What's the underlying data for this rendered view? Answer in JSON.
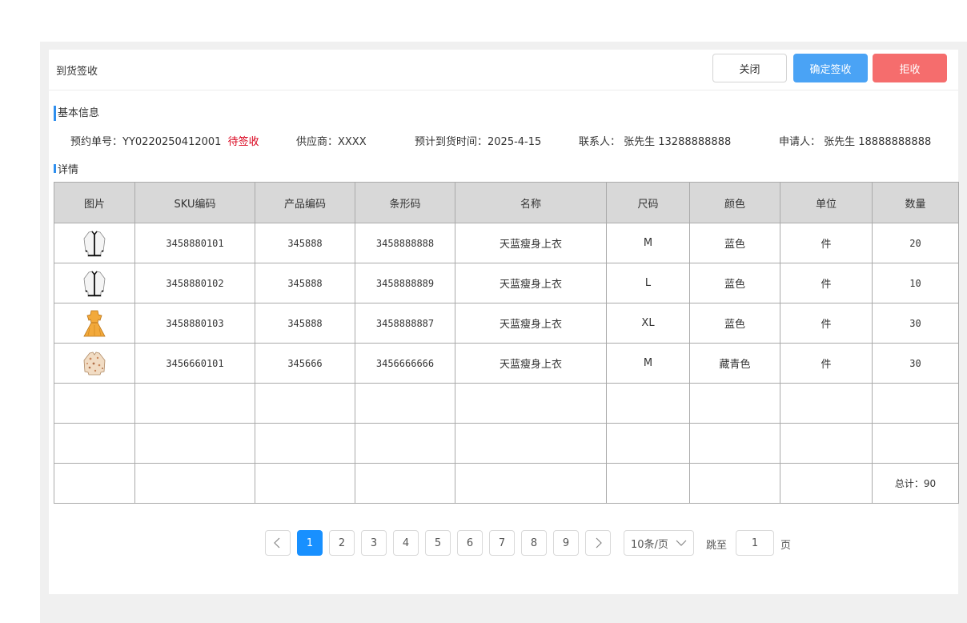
{
  "header": {
    "title": "到货签收",
    "close_label": "关闭",
    "confirm_label": "确定签收",
    "reject_label": "拒收"
  },
  "basic": {
    "section_title": "基本信息",
    "order_label": "预约单号：",
    "order_no": "YY0220250412001",
    "status": "待签收",
    "supplier": "供应商：XXXX",
    "eta": "预计到货时间：2025-4-15",
    "contact": "联系人：  张先生  13288888888",
    "applicant": "申请人：  张先生 18888888888"
  },
  "detail": {
    "section_title": "详情",
    "columns": [
      "图片",
      "SKU编码",
      "产品编码",
      "条形码",
      "名称",
      "尺码",
      "颜色",
      "单位",
      "数量"
    ],
    "rows": [
      {
        "image": "white-cardigan-icon",
        "sku": "3458880101",
        "product_code": "345888",
        "barcode": "3458888888",
        "name": "天蓝瘦身上衣",
        "size": "M",
        "color": "蓝色",
        "unit": "件",
        "qty": "20"
      },
      {
        "image": "white-cardigan-icon",
        "sku": "3458880102",
        "product_code": "345888",
        "barcode": "3458888889",
        "name": "天蓝瘦身上衣",
        "size": "L",
        "color": "蓝色",
        "unit": "件",
        "qty": "10"
      },
      {
        "image": "yellow-dress-icon",
        "sku": "3458880103",
        "product_code": "345888",
        "barcode": "3458888887",
        "name": "天蓝瘦身上衣",
        "size": "XL",
        "color": "蓝色",
        "unit": "件",
        "qty": "30"
      },
      {
        "image": "floral-blouse-icon",
        "sku": "3456660101",
        "product_code": "345666",
        "barcode": "3456666666",
        "name": "天蓝瘦身上衣",
        "size": "M",
        "color": "藏青色",
        "unit": "件",
        "qty": "30"
      }
    ],
    "total": "总计：90"
  },
  "pagination": {
    "pages": [
      "1",
      "2",
      "3",
      "4",
      "5",
      "6",
      "7",
      "8",
      "9"
    ],
    "current": "1",
    "page_size": "10条/页",
    "jump_label": "跳至",
    "jump_value": "1",
    "page_unit": "页"
  },
  "colors": {
    "accent": "#4aa3f5",
    "danger": "#f56d6d",
    "status": "#d9001b",
    "pager_active": "#1890ff"
  }
}
